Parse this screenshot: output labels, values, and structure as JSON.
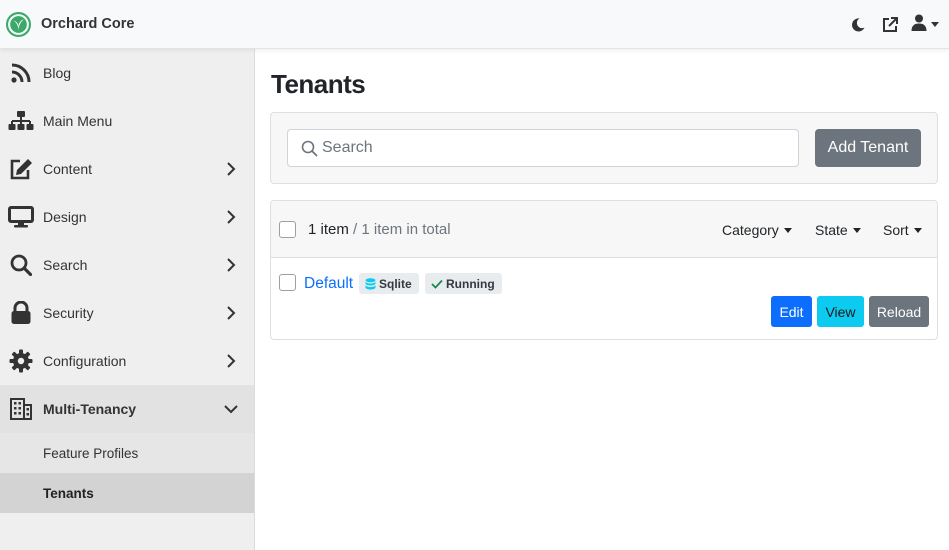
{
  "app": {
    "name": "Orchard Core",
    "brand_color": "#3aa96a"
  },
  "header": {
    "icons": [
      "moon-icon",
      "external-link-icon",
      "user-icon"
    ]
  },
  "sidebar": {
    "items": [
      {
        "label": "Blog",
        "icon": "rss-icon",
        "has_chevron": false
      },
      {
        "label": "Main Menu",
        "icon": "sitemap-icon",
        "has_chevron": false
      },
      {
        "label": "Content",
        "icon": "edit-icon",
        "has_chevron": true
      },
      {
        "label": "Design",
        "icon": "monitor-icon",
        "has_chevron": true
      },
      {
        "label": "Search",
        "icon": "search-icon",
        "has_chevron": true
      },
      {
        "label": "Security",
        "icon": "lock-icon",
        "has_chevron": true
      },
      {
        "label": "Configuration",
        "icon": "gear-icon",
        "has_chevron": true
      },
      {
        "label": "Multi-Tenancy",
        "icon": "building-icon",
        "has_chevron": true,
        "expanded": true
      }
    ],
    "sub_items": [
      {
        "label": "Feature Profiles",
        "active": false
      },
      {
        "label": "Tenants",
        "active": true
      }
    ]
  },
  "main": {
    "title": "Tenants",
    "search": {
      "placeholder": "Search",
      "value": ""
    },
    "add_button": "Add Tenant",
    "list": {
      "count_label": "1 item",
      "total_label": "/ 1 item in total",
      "filters": [
        "Category",
        "State",
        "Sort"
      ],
      "rows": [
        {
          "name": "Default",
          "database_badge": "Sqlite",
          "state_badge": "Running",
          "actions": {
            "edit": "Edit",
            "view": "View",
            "reload": "Reload"
          }
        }
      ]
    }
  }
}
